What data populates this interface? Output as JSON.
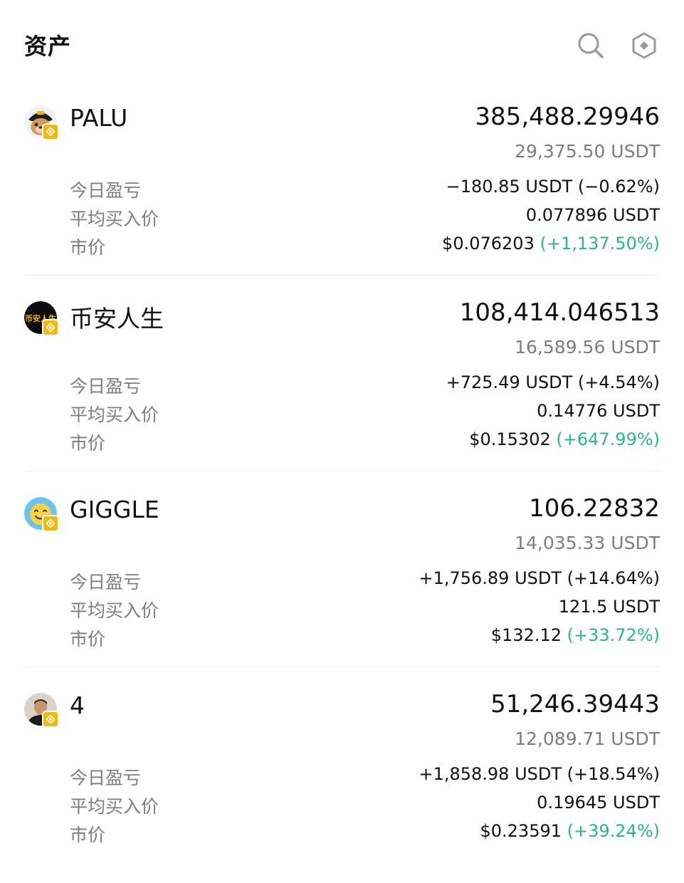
{
  "header": {
    "title": "资产",
    "icons": [
      "search-icon",
      "hexagon-settings-icon"
    ]
  },
  "labels": {
    "today_pnl": "今日盈亏",
    "avg_buy_price": "平均买入价",
    "market_price": "市价"
  },
  "colors": {
    "negative": "#f0404f",
    "positive": "#2bb686",
    "badge": "#f0b90b"
  },
  "assets": [
    {
      "name": "PALU",
      "quantity": "385,488.29946",
      "value": "29,375.50 USDT",
      "today_pnl": "−180.85 USDT (−0.62%)",
      "today_pnl_sign": "negative",
      "avg_buy_price": "0.077896 USDT",
      "market_price": "$0.076203",
      "market_change": "(+1,137.50%)",
      "avatar_icon": "palu-dog-avatar-icon"
    },
    {
      "name": "币安人生",
      "quantity": "108,414.046513",
      "value": "16,589.56 USDT",
      "today_pnl": "+725.49 USDT (+4.54%)",
      "today_pnl_sign": "positive",
      "avg_buy_price": "0.14776 USDT",
      "market_price": "$0.15302",
      "market_change": "(+647.99%)",
      "avatar_text": "币安人生",
      "avatar_icon": "binance-life-avatar-icon"
    },
    {
      "name": "GIGGLE",
      "quantity": "106.22832",
      "value": "14,035.33 USDT",
      "today_pnl": "+1,756.89 USDT (+14.64%)",
      "today_pnl_sign": "positive",
      "avg_buy_price": "121.5 USDT",
      "market_price": "$132.12",
      "market_change": "(+33.72%)",
      "avatar_icon": "giggle-smiley-avatar-icon"
    },
    {
      "name": "4",
      "quantity": "51,246.39443",
      "value": "12,089.71 USDT",
      "today_pnl": "+1,858.98 USDT (+18.54%)",
      "today_pnl_sign": "positive",
      "avg_buy_price": "0.19645 USDT",
      "market_price": "$0.23591",
      "market_change": "(+39.24%)",
      "avatar_icon": "person-photo-avatar-icon"
    }
  ]
}
